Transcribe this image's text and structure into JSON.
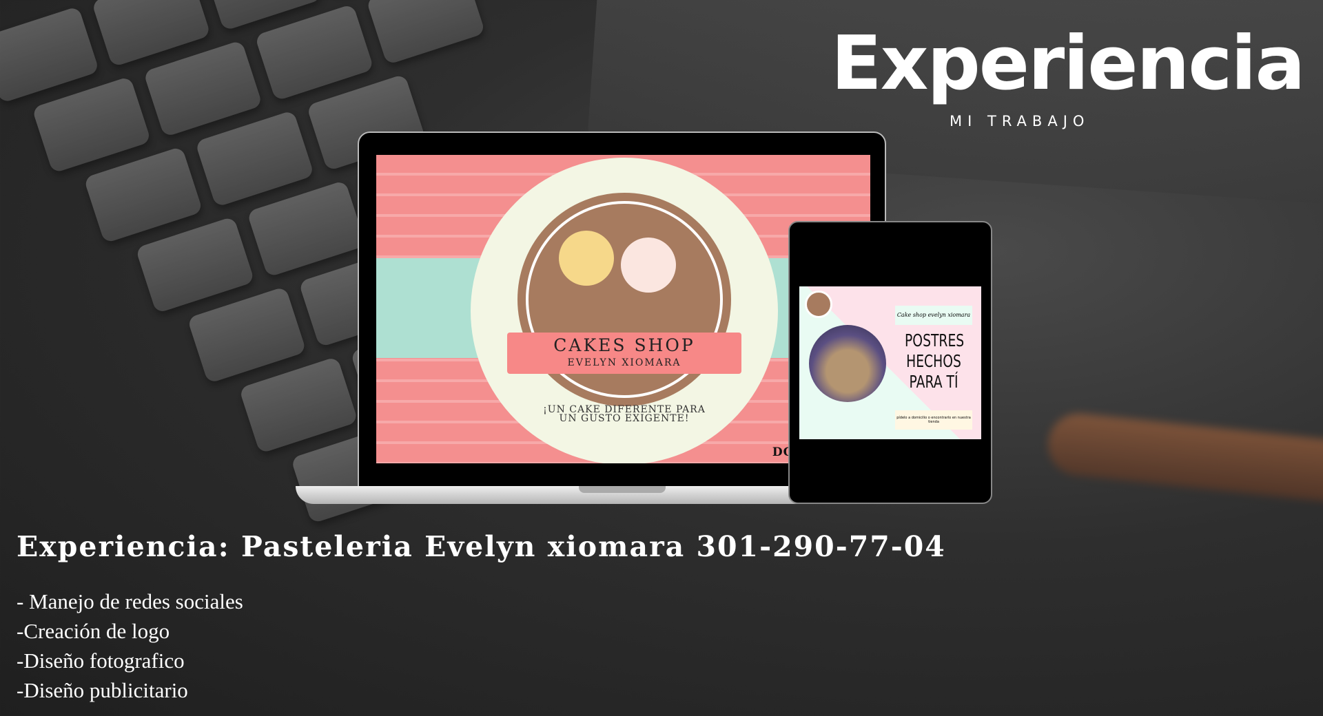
{
  "header": {
    "title": "Experiencia",
    "subtitle": "MI TRABAJO"
  },
  "laptop_screen": {
    "brand": "CAKES SHOP",
    "owner": "EVELYN XIOMARA",
    "slogan_line1": "¡UN CAKE DIFERENTE PARA",
    "slogan_line2": "UN GUSTO EXIGENTE!",
    "delivery": "DOMICILIOS:"
  },
  "tablet_screen": {
    "tagline": "Cake shop evelyn xiomara",
    "headline_line1": "POSTRES",
    "headline_line2": "HECHOS",
    "headline_line3": "PARA TÍ",
    "footer": "pídelo a domicilio o encontrarlo en nuestra tienda"
  },
  "experience": {
    "heading": "Experiencia: Pasteleria Evelyn xiomara 301-290-77-04",
    "items": [
      "- Manejo de redes sociales",
      "-Creación de logo",
      "-Diseño fotografico",
      "-Diseño publicitario"
    ]
  }
}
